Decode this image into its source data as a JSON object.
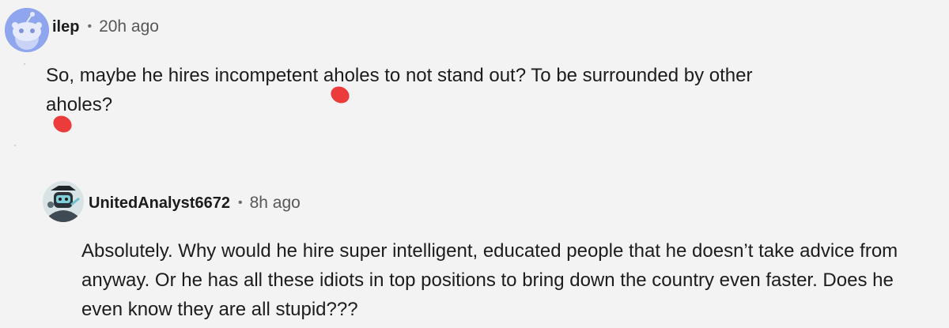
{
  "comments": [
    {
      "username": "ilep",
      "separator": "•",
      "time": "20h ago",
      "icon": "snoo-avatar-icon",
      "body_parts": [
        "So, maybe he hires incompetent a",
        "holes to not stand out? To be surrounded by other",
        "a",
        "holes?"
      ]
    },
    {
      "username": "UnitedAnalyst6672",
      "separator": "•",
      "time": "8h ago",
      "icon": "robot-avatar-icon",
      "body": "Absolutely. Why would he hire super intelligent, educated people that he doesn’t take advice from anyway. Or he has all these idiots in top positions to bring down the country even faster. Does he even know they are all stupid???"
    }
  ],
  "colors": {
    "background": "#f3f3f3",
    "text": "#1c1c1c",
    "meta_text": "#575757",
    "censor": "#ec3b3b",
    "avatar_1": "#8fa6ee"
  }
}
